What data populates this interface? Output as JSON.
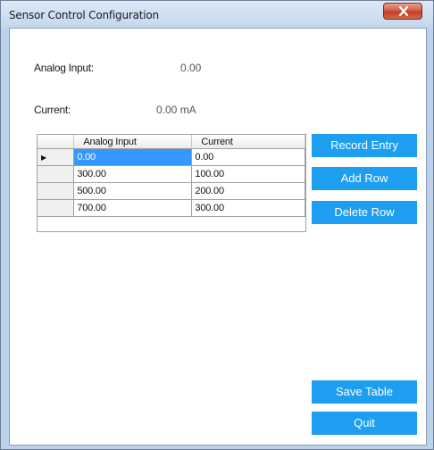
{
  "window": {
    "title": "Sensor Control Configuration"
  },
  "readouts": {
    "analog_input_label": "Analog Input:",
    "analog_input_value": "0.00",
    "current_label": "Current:",
    "current_value": "0.00 mA"
  },
  "table": {
    "columns": [
      "Analog Input",
      "Current"
    ],
    "selected_row_marker": "▶",
    "rows": [
      [
        "0.00",
        "0.00"
      ],
      [
        "300.00",
        "100.00"
      ],
      [
        "500.00",
        "200.00"
      ],
      [
        "700.00",
        "300.00"
      ]
    ]
  },
  "buttons": {
    "record_entry": "Record Entry",
    "add_row": "Add Row",
    "delete_row": "Delete Row",
    "save_table": "Save Table",
    "quit": "Quit"
  },
  "colors": {
    "button_bg": "#1e9ef0",
    "selection": "#3399ff"
  }
}
